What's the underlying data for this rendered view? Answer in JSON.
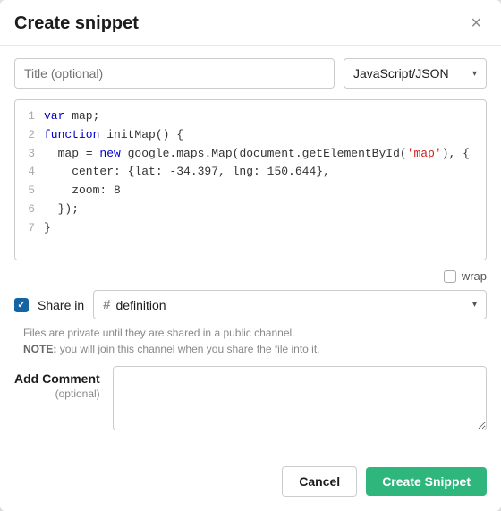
{
  "header": {
    "title": "Create snippet",
    "close_label": "×"
  },
  "title_input": {
    "placeholder": "Title (optional)"
  },
  "language_select": {
    "value": "JavaScript/JSON",
    "chevron": "▾"
  },
  "code": {
    "lines": [
      {
        "num": "1",
        "html": "<span class='kw'>var</span> map;"
      },
      {
        "num": "2",
        "html": "<span class='kw'>function</span> initMap() {"
      },
      {
        "num": "3",
        "html": "  map = <span class='kw'>new</span> google.maps.Map(document.getElementById(<span class='str'>'map'</span>), {"
      },
      {
        "num": "4",
        "html": "    center: {lat: -34.397, lng: 150.644},"
      },
      {
        "num": "5",
        "html": "    zoom: 8"
      },
      {
        "num": "6",
        "html": "  });"
      },
      {
        "num": "7",
        "html": "}"
      }
    ]
  },
  "wrap": {
    "label": "wrap"
  },
  "share": {
    "checkbox_checked": true,
    "label": "Share in",
    "channel": "definition",
    "channel_icon": "#",
    "chevron": "▾",
    "info_line1": "Files are private until they are shared in a public channel.",
    "info_line2": "NOTE: you will join this channel when you share the file into it."
  },
  "comment": {
    "label": "Add Comment",
    "optional": "(optional)"
  },
  "footer": {
    "cancel_label": "Cancel",
    "create_label": "Create Snippet"
  }
}
